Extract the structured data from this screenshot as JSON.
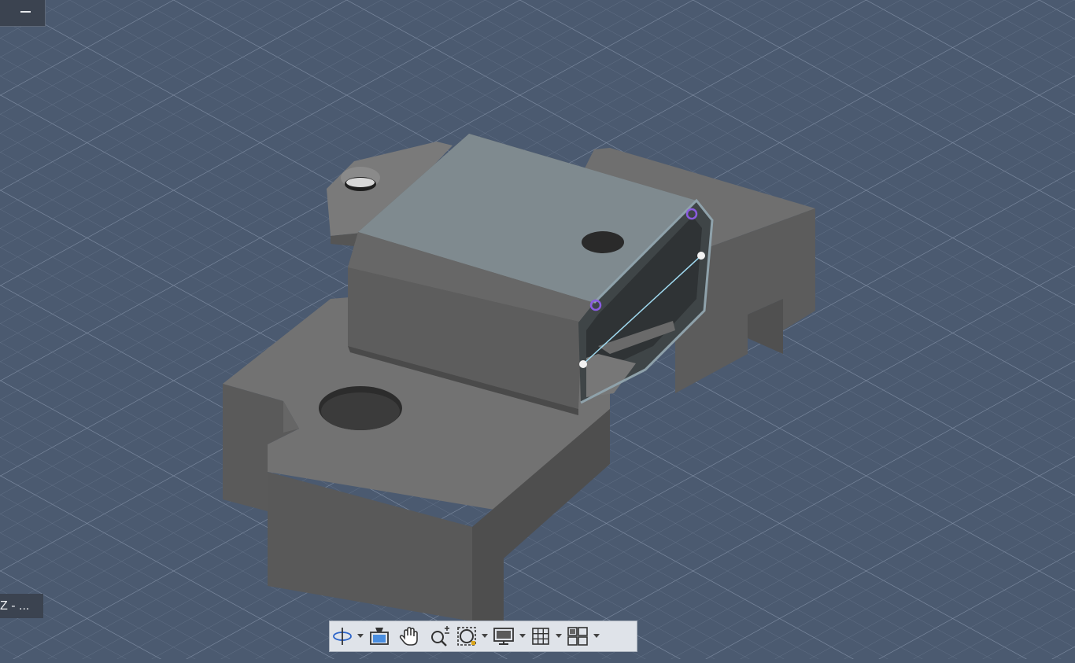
{
  "viewport": {
    "background_color": "#4b5a70",
    "grid_color": "#6e7c92",
    "model_color": "#6f6f6f",
    "top_face_color": "#7f8a8f",
    "highlight_color": "#9fd8ee",
    "selection_color": "#8a5ce0"
  },
  "minimize_button": {
    "icon": "minus-icon"
  },
  "view_label": {
    "text": "Z - ..."
  },
  "navbar": {
    "items": [
      {
        "name": "orbit",
        "icon": "orbit-icon",
        "has_dropdown": true
      },
      {
        "name": "look-at",
        "icon": "look-at-icon",
        "has_dropdown": false
      },
      {
        "name": "pan",
        "icon": "pan-hand-icon",
        "has_dropdown": false
      },
      {
        "name": "zoom",
        "icon": "zoom-icon",
        "has_dropdown": false
      },
      {
        "name": "fit",
        "icon": "fit-window-icon",
        "has_dropdown": true
      },
      {
        "name": "display-settings",
        "icon": "display-icon",
        "has_dropdown": true
      },
      {
        "name": "grid-snaps",
        "icon": "grid-icon",
        "has_dropdown": true
      },
      {
        "name": "viewports",
        "icon": "viewports-icon",
        "has_dropdown": true
      }
    ]
  }
}
